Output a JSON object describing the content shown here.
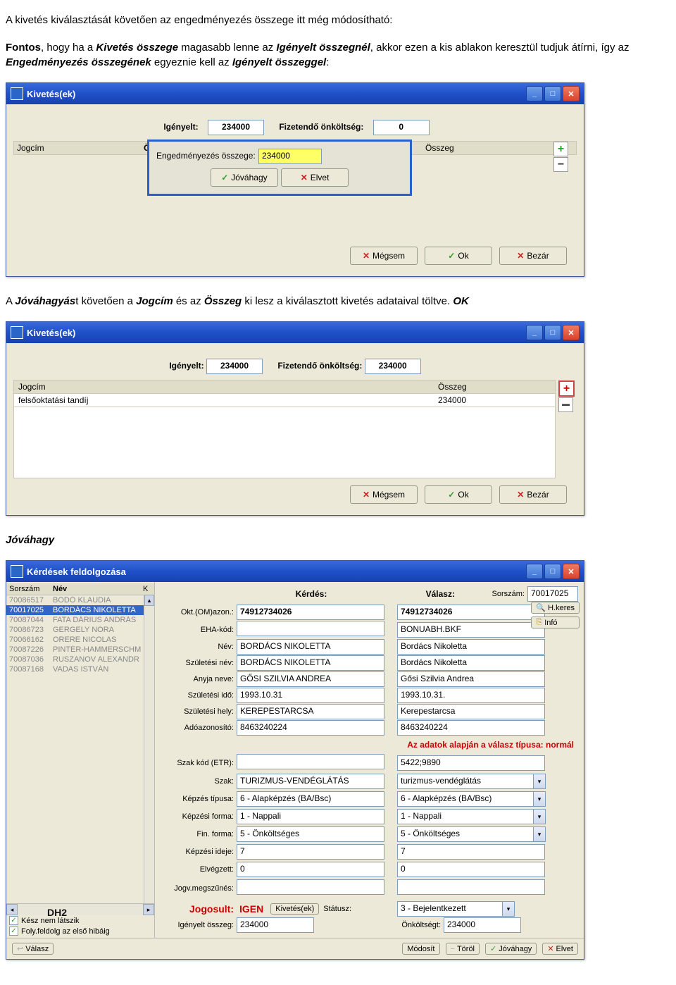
{
  "para1_a": "A kivetés kiválasztását követően az engedményezés összege itt még módosítható:",
  "para2_prefix": "Fontos",
  "para2_a": ", hogy ha a ",
  "para2_b": "Kivetés összege",
  "para2_c": " magasabb lenne az ",
  "para2_d": "Igényelt összegnél",
  "para2_e": ", akkor ezen a kis ablakon keresztül tudjuk átírni, így az ",
  "para2_f": "Engedményezés összegének",
  "para2_g": " egyeznie kell az ",
  "para2_h": "Igényelt összeggel",
  "para2_i": ":",
  "s1": {
    "title": "Kivetés(ek)",
    "igenyelt_label": "Igényelt:",
    "igenyelt_value": "234000",
    "fiz_label": "Fizetendő önköltség:",
    "fiz_value": "0",
    "th_jogcim": "Jogcím",
    "th_osszeg": "Összeg",
    "th_osszeg2": "Összeg",
    "popup_label": "Engedményezés összege:",
    "popup_value": "234000",
    "btn_jovahagy": "Jóváhagy",
    "btn_elvet": "Elvet",
    "btn_megsem": "Mégsem",
    "btn_ok": "Ok",
    "btn_bezar": "Bezár"
  },
  "para3_a": "A ",
  "para3_b": "Jóváhagyás",
  "para3_c": "t követően a ",
  "para3_d": "Jogcím",
  "para3_e": " és az ",
  "para3_f": "Összeg",
  "para3_g": " ki lesz a kiválasztott kivetés adataival töltve. ",
  "para3_h": "OK",
  "s2": {
    "title": "Kivetés(ek)",
    "igenyelt_label": "Igényelt:",
    "igenyelt_value": "234000",
    "fiz_label": "Fizetendő önköltség:",
    "fiz_value": "234000",
    "th_jogcim": "Jogcím",
    "th_osszeg": "Összeg",
    "row_jogcim": "felsőoktatási tandíj",
    "row_osszeg": "234000",
    "btn_megsem": "Mégsem",
    "btn_ok": "Ok",
    "btn_bezar": "Bezár"
  },
  "para4": "Jóváhagy",
  "s3": {
    "title": "Kérdések feldolgozása",
    "left_h1": "Sorszám",
    "left_h2": "Név",
    "left_h3": "K",
    "rows": [
      {
        "sor": "70086517",
        "nev": "BODÓ KLAUDIA"
      },
      {
        "sor": "70017025",
        "nev": "BORDÁCS NIKOLETTA"
      },
      {
        "sor": "70087044",
        "nev": "FATA DÁRIUS ANDRÁS"
      },
      {
        "sor": "70086723",
        "nev": "GERGELY NÓRA"
      },
      {
        "sor": "70066162",
        "nev": "ORERE NICOLAS"
      },
      {
        "sor": "70087226",
        "nev": "PINTÉR-HAMMERSCHM"
      },
      {
        "sor": "70087036",
        "nev": "RUSZANOV ALEXANDR"
      },
      {
        "sor": "70087168",
        "nev": "VADAS ISTVÁN"
      }
    ],
    "chk1": "Kész nem látszik",
    "chk2": "Foly.feldolg az első hibáig",
    "kerdes": "Kérdés:",
    "valasz": "Válasz:",
    "sorszam_label": "Sorszám:",
    "sorszam_value": "70017025",
    "btn_hkeres": "H.keres",
    "btn_info": "Infó",
    "fields": [
      {
        "lab": "Okt.(OM)azon.:",
        "v1": "74912734026",
        "v2": "74912734026"
      },
      {
        "lab": "EHA-kód:",
        "v1": "",
        "v2": "BONUABH.BKF"
      },
      {
        "lab": "Név:",
        "v1": "BORDÁCS NIKOLETTA",
        "v2": "Bordács Nikoletta"
      },
      {
        "lab": "Születési név:",
        "v1": "BORDÁCS NIKOLETTA",
        "v2": "Bordács Nikoletta"
      },
      {
        "lab": "Anyja neve:",
        "v1": "GŐSI SZILVIA ANDREA",
        "v2": "Gősi Szilvia Andrea"
      },
      {
        "lab": "Születési idő:",
        "v1": "1993.10.31",
        "v2": "1993.10.31."
      },
      {
        "lab": "Születési hely:",
        "v1": "KEREPESTARCSA",
        "v2": "Kerepestarcsa"
      },
      {
        "lab": "Adóazonosító:",
        "v1": "8463240224",
        "v2": "8463240224"
      }
    ],
    "redline": "Az adatok alapján a válasz típusa: normál",
    "fields2": [
      {
        "lab": "Szak kód (ETR):",
        "v1": "",
        "v2": "5422;9890",
        "combo": false
      },
      {
        "lab": "Szak:",
        "v1": "TURIZMUS-VENDÉGLÁTÁS",
        "v2": "turizmus-vendéglátás",
        "combo": true
      },
      {
        "lab": "Képzés típusa:",
        "v1": "6 - Alapképzés (BA/Bsc)",
        "v2": "6 - Alapképzés (BA/Bsc)",
        "combo": true
      },
      {
        "lab": "Képzési forma:",
        "v1": "1 - Nappali",
        "v2": "1 - Nappali",
        "combo": true
      },
      {
        "lab": "Fin. forma:",
        "v1": "5 - Önköltséges",
        "v2": "5 - Önköltséges",
        "combo": true
      },
      {
        "lab": "Képzési ideje:",
        "v1": "7",
        "v2": "7",
        "combo": false
      },
      {
        "lab": "Elvégzett:",
        "v1": "0",
        "v2": "0",
        "combo": false
      },
      {
        "lab": "Jogv.megszűnés:",
        "v1": "",
        "v2": "",
        "combo": false
      }
    ],
    "jogosult_label": "Jogosult:",
    "jogosult_value": "IGEN",
    "btn_kivetesek": "Kivetés(ek)",
    "statusz_label": "Státusz:",
    "statusz_value": "3 - Bejelentkezett",
    "ig_osszeg_label": "Igényelt összeg:",
    "ig_osszeg_value": "234000",
    "onk_label": "Önköltségt:",
    "onk_value": "234000",
    "dh2": "DH2",
    "footer_valasz": "Válasz",
    "footer_modosit": "Módosít",
    "footer_torol": "Töröl",
    "footer_jovahagy": "Jóváhagy",
    "footer_elvet": "Elvet"
  }
}
